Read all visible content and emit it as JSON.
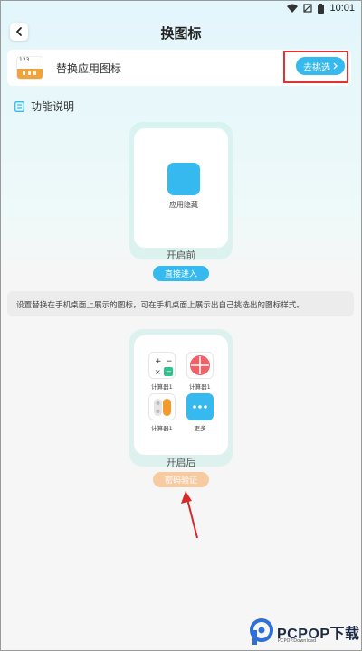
{
  "status": {
    "time": "10:01"
  },
  "header": {
    "title": "换图标"
  },
  "replace_card": {
    "label": "替换应用图标",
    "thumb_number": "123",
    "button_label": "去挑选"
  },
  "description": {
    "label": "功能说明"
  },
  "before": {
    "app_label": "应用隐藏",
    "state_label": "开启前",
    "button_label": "直接进入"
  },
  "info_text": "设置替换在手机桌面上展示的图标，可在手机桌面上展示出自己挑选出的图标样式。",
  "after": {
    "state_label": "开启后",
    "button_label": "密码验证",
    "icons": [
      {
        "label": "计算器1",
        "icon": "calculator-icon"
      },
      {
        "label": "计算器1",
        "icon": "calculator-round-icon"
      },
      {
        "label": "计算器1",
        "icon": "calculator-toggle-icon"
      },
      {
        "label": "更多",
        "icon": "more-icon"
      }
    ]
  },
  "watermark": {
    "brand": "PCPOP下载",
    "sub": "PCPOP.Download"
  },
  "colors": {
    "accent": "#35b9ee",
    "highlight_red": "#e33030",
    "password_orange": "#f6cba2"
  }
}
